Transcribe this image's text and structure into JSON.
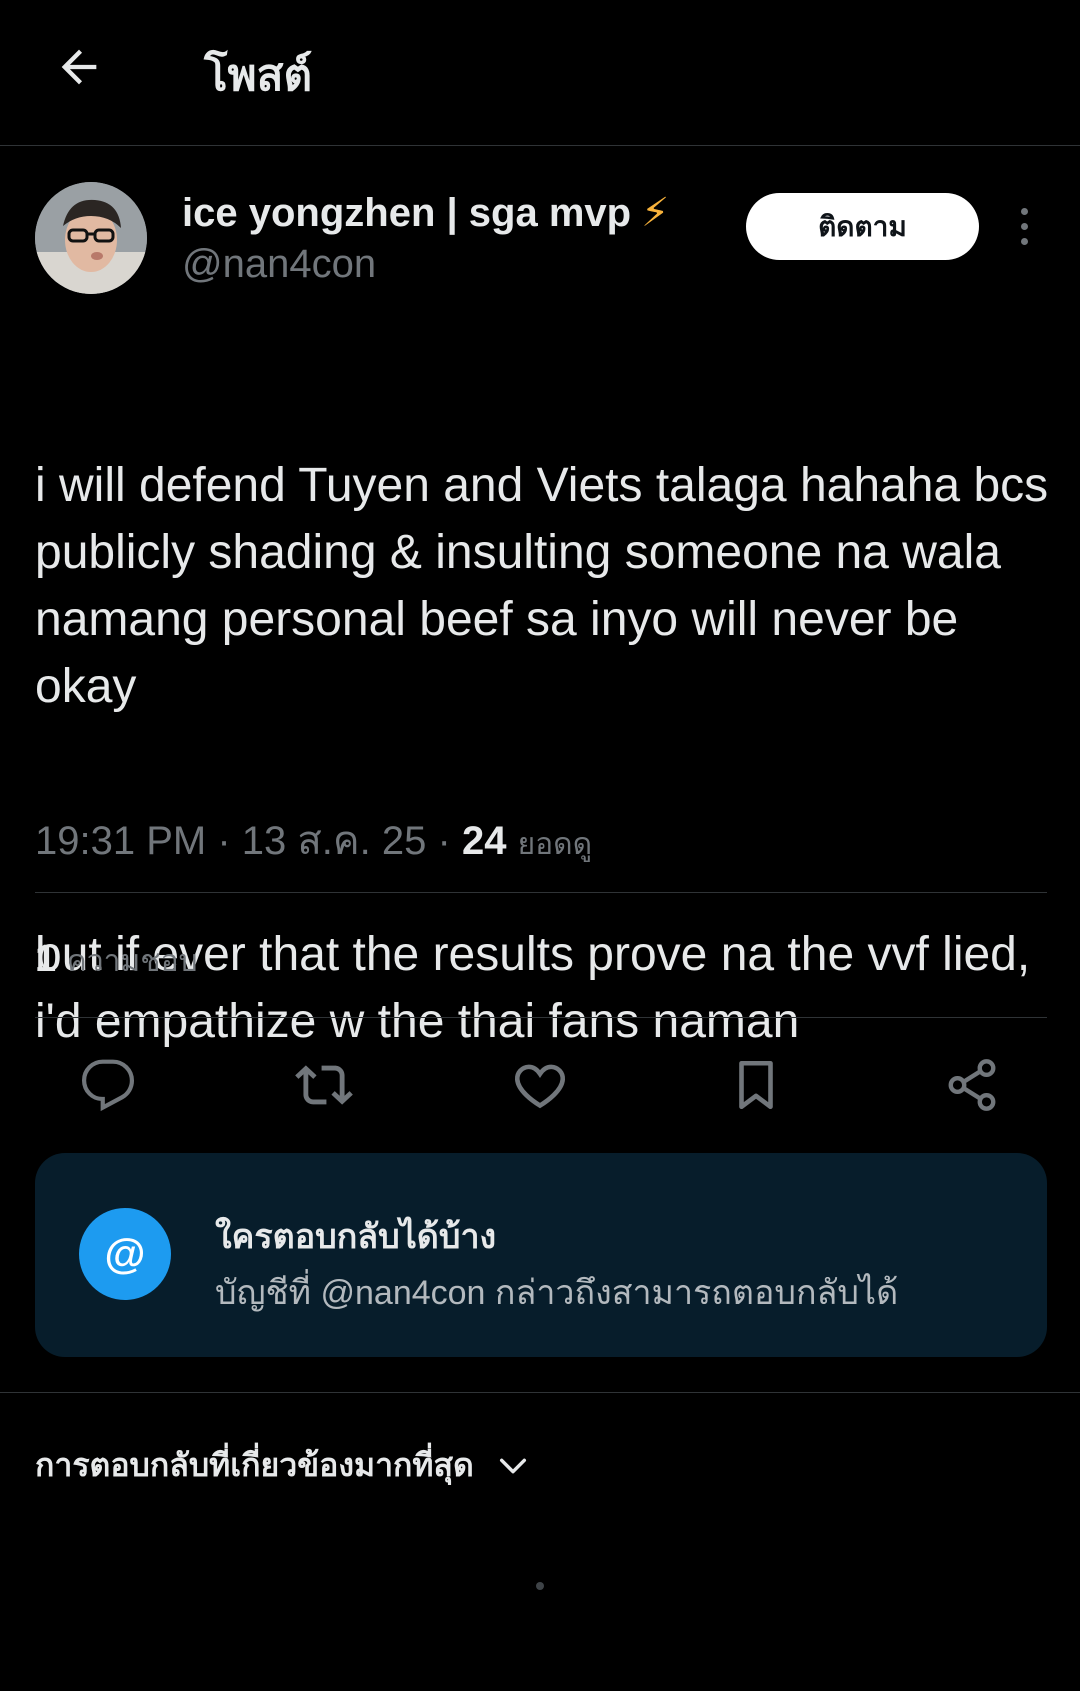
{
  "header": {
    "title": "โพสต์",
    "back_icon": "arrow-left-icon"
  },
  "author": {
    "name": "ice yongzhen | sga mvp",
    "badge": "⚡",
    "handle": "@nan4con",
    "follow_label": "ติดตาม"
  },
  "tweet": {
    "paragraphs": [
      "i will defend Tuyen and Viets talaga hahaha bcs publicly shading & insulting someone na wala namang personal beef sa inyo will never be okay",
      "but if ever that the results prove na the vvf lied, i'd empathize w the thai fans naman"
    ],
    "time": "19:31 PM",
    "date": "13 ส.ค. 25",
    "views_count": "24",
    "views_label": "ยอดดู"
  },
  "stats": {
    "likes_count": "1",
    "likes_label": "ความชอบ"
  },
  "actions": [
    "reply-icon",
    "repost-icon",
    "like-icon",
    "bookmark-icon",
    "share-icon"
  ],
  "reply_settings": {
    "icon_text": "@",
    "title": "ใครตอบกลับได้บ้าง",
    "description": "บัญชีที่ @nan4con กล่าวถึงสามารถตอบกลับได้"
  },
  "replies_sort": {
    "label": "การตอบกลับที่เกี่ยวข้องมากที่สุด"
  },
  "colors": {
    "background": "#000000",
    "text": "#e7e9ea",
    "muted": "#71767b",
    "accent": "#1d9bf0",
    "card": "#071d2b"
  }
}
